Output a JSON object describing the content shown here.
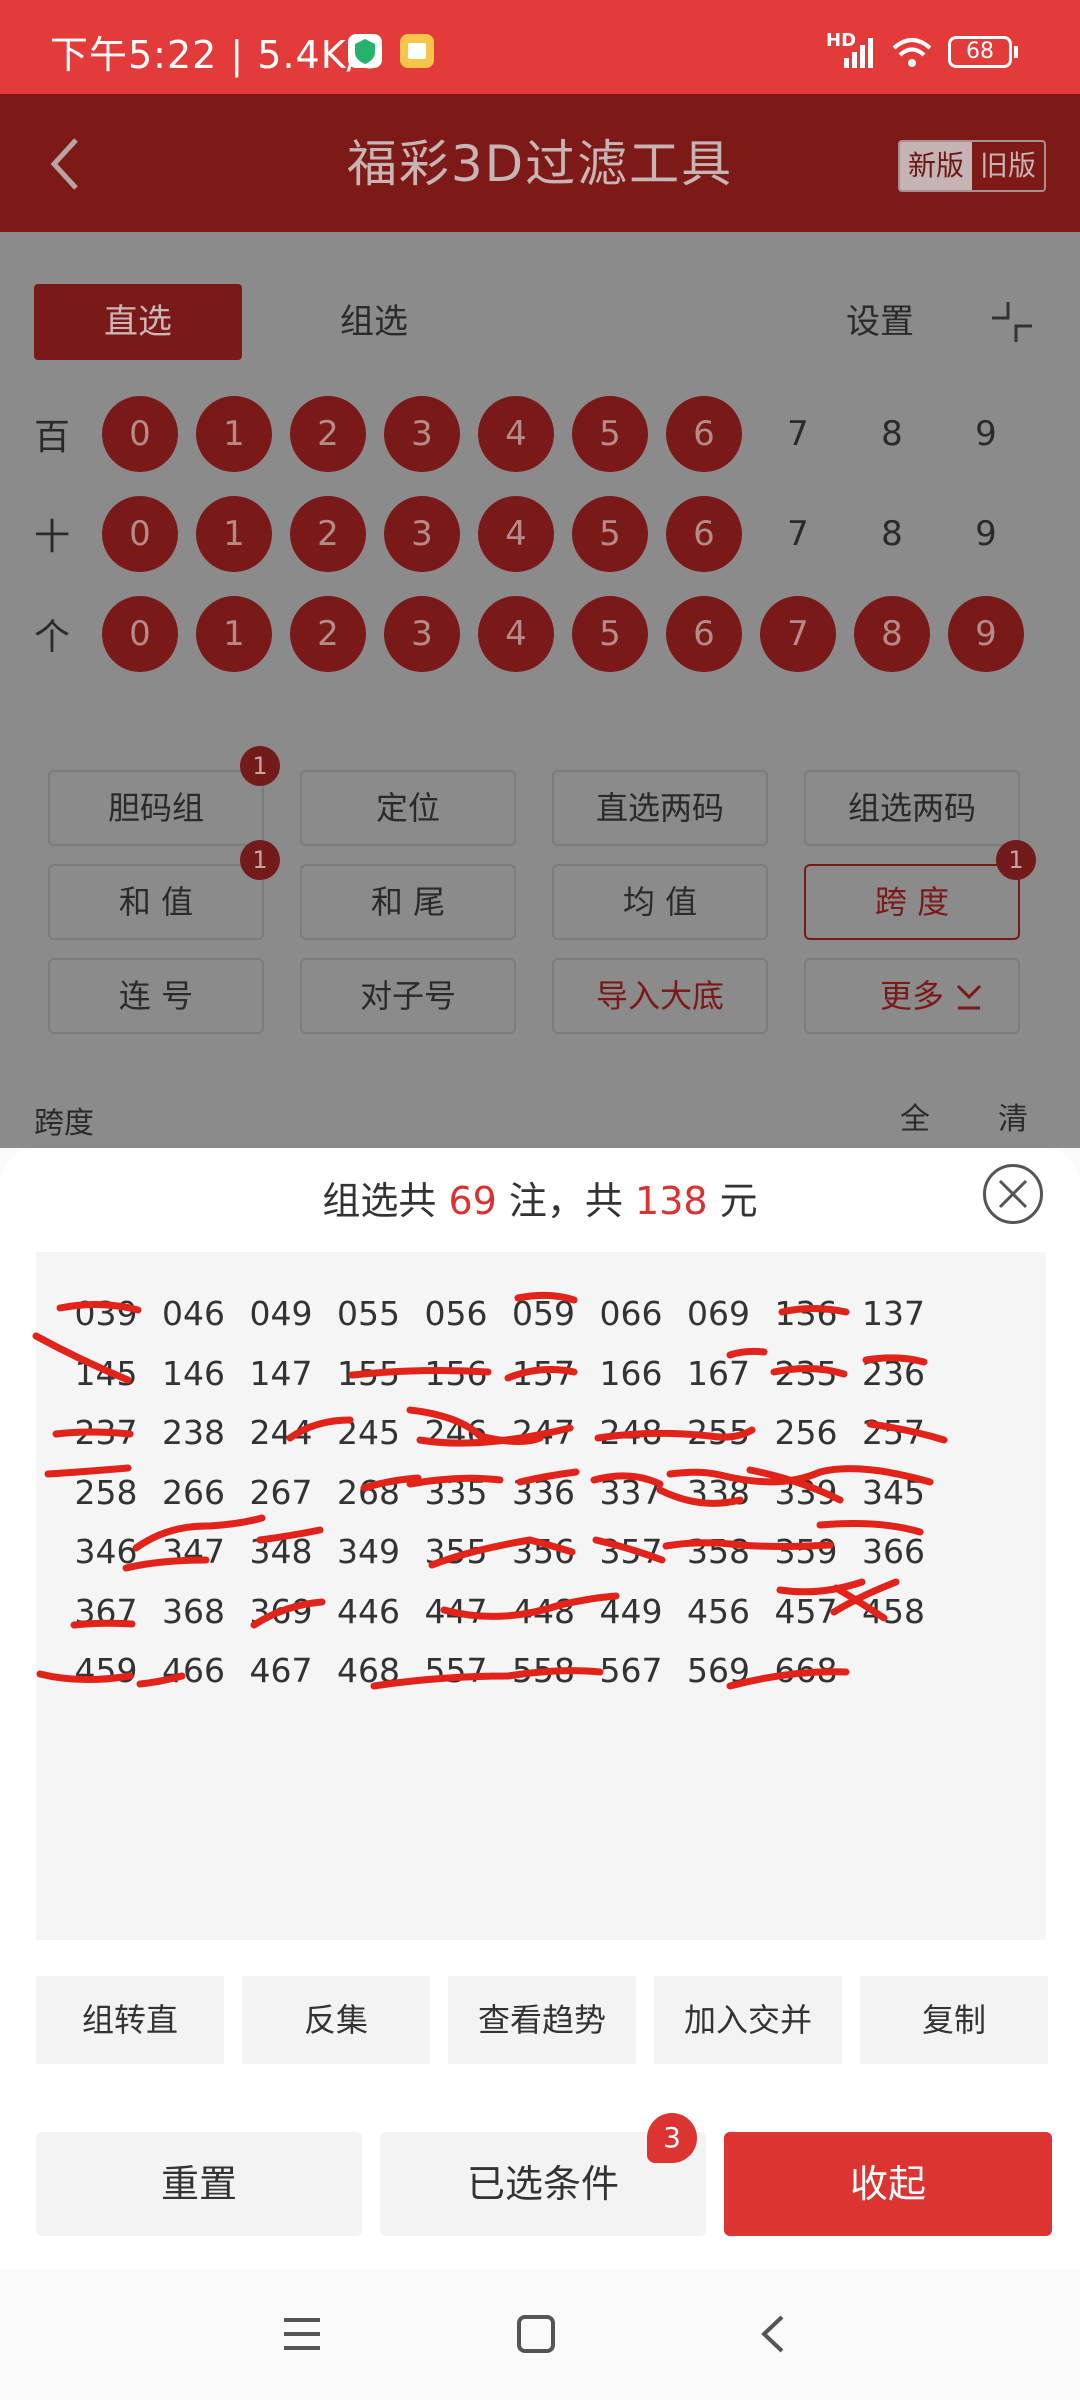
{
  "status_bar": {
    "time": "下午5:22 | 5.4K/s",
    "network": "HD",
    "battery": "68"
  },
  "header": {
    "title": "福彩3D过滤工具",
    "version_new": "新版",
    "version_old": "旧版",
    "back_icon": "back-arrow-icon"
  },
  "tabs": {
    "direct": "直选",
    "group": "组选",
    "settings": "设置"
  },
  "digits": {
    "hundreds": {
      "label": "百",
      "selected": [
        0,
        1,
        2,
        3,
        4,
        5,
        6
      ]
    },
    "tens": {
      "label": "十",
      "selected": [
        0,
        1,
        2,
        3,
        4,
        5,
        6
      ]
    },
    "units": {
      "label": "个",
      "selected": [
        0,
        1,
        2,
        3,
        4,
        5,
        6,
        7,
        8,
        9
      ]
    },
    "values": [
      "0",
      "1",
      "2",
      "3",
      "4",
      "5",
      "6",
      "7",
      "8",
      "9"
    ]
  },
  "conditions": [
    {
      "label": "胆码组",
      "badge": "1"
    },
    {
      "label": "定位",
      "badge": ""
    },
    {
      "label": "直选两码",
      "badge": ""
    },
    {
      "label": "组选两码",
      "badge": ""
    },
    {
      "label": "和 值",
      "badge": "1"
    },
    {
      "label": "和 尾",
      "badge": ""
    },
    {
      "label": "均 值",
      "badge": ""
    },
    {
      "label": "跨 度",
      "badge": "1"
    },
    {
      "label": "连 号",
      "badge": ""
    },
    {
      "label": "对子号",
      "badge": ""
    },
    {
      "label": "导入大底",
      "badge": ""
    },
    {
      "label": "更多",
      "badge": ""
    }
  ],
  "section": {
    "label": "跨度",
    "all": "全",
    "clear": "清"
  },
  "sheet": {
    "summary_prefix": "组选共",
    "count": "69",
    "summary_mid": "注，共",
    "amount": "138",
    "summary_suffix": "元",
    "numbers": [
      "039",
      "046",
      "049",
      "055",
      "056",
      "059",
      "066",
      "069",
      "136",
      "137",
      "145",
      "146",
      "147",
      "155",
      "156",
      "157",
      "166",
      "167",
      "235",
      "236",
      "237",
      "238",
      "244",
      "245",
      "246",
      "247",
      "248",
      "255",
      "256",
      "257",
      "258",
      "266",
      "267",
      "268",
      "335",
      "336",
      "337",
      "338",
      "339",
      "345",
      "346",
      "347",
      "348",
      "349",
      "355",
      "356",
      "357",
      "358",
      "359",
      "366",
      "367",
      "368",
      "369",
      "446",
      "447",
      "448",
      "449",
      "456",
      "457",
      "458",
      "459",
      "466",
      "467",
      "468",
      "557",
      "558",
      "567",
      "569",
      "668"
    ],
    "actions": [
      "组转直",
      "反集",
      "查看趋势",
      "加入交并",
      "复制"
    ],
    "reset": "重置",
    "selected_conditions": "已选条件",
    "selected_count": "3",
    "collapse": "收起"
  },
  "colors": {
    "accent": "#db3431",
    "dim_red": "#7a1a18",
    "statusbar": "#e33b3a"
  }
}
